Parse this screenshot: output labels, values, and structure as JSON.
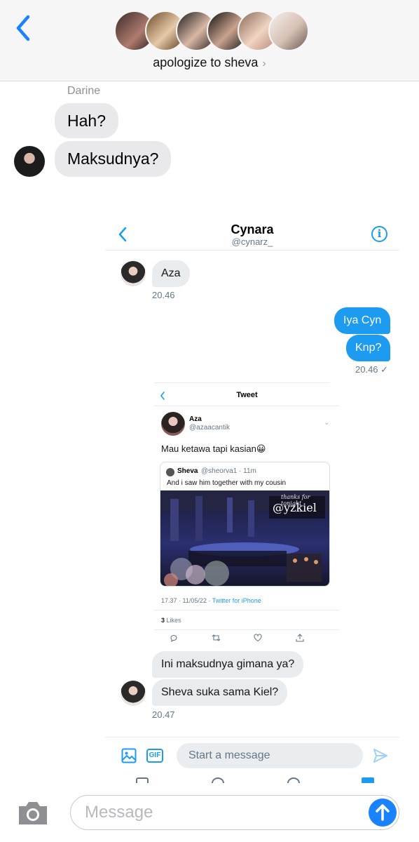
{
  "header": {
    "group_title": "apologize to sheva",
    "title_chevron": "›",
    "member_count": 6
  },
  "thread": {
    "sender_name": "Darine",
    "messages": [
      {
        "text": "Hah?"
      },
      {
        "text": "Maksudnya?"
      }
    ]
  },
  "twitter_dm": {
    "contact_name": "Cynara",
    "contact_handle": "@cynarz_",
    "info_icon": "i",
    "incoming_1": "Aza",
    "time_1": "20.46",
    "outgoing": [
      "Iya Cyn",
      "Knp?"
    ],
    "time_2": "20.46 ✓",
    "tweet": {
      "header": "Tweet",
      "author_name": "Aza",
      "author_handle": "@azaacantik",
      "text": "Mau ketawa tapi kasian😀",
      "quote": {
        "name": "Sheva",
        "handle_time": "@sheorva1 · 11m",
        "text": "And i saw him together with my cousin",
        "image_caption_small": "thanks for tonight",
        "image_caption_large": "@yzkiel"
      },
      "meta_time": "17.37 · 11/05/22 · ",
      "meta_source": "Twitter for iPhone",
      "likes_count": "3",
      "likes_label": " Likes"
    },
    "incoming_2": "Ini maksudnya gimana ya?",
    "incoming_3": "Sheva suka sama Kiel?",
    "time_3": "20.47",
    "composer_placeholder": "Start a message",
    "gif_label": "GIF"
  },
  "input": {
    "placeholder": "Message"
  },
  "colors": {
    "imessage_blue": "#1a82fb",
    "twitter_blue": "#1d9bf0",
    "incoming_gray": "#e9e9eb"
  }
}
